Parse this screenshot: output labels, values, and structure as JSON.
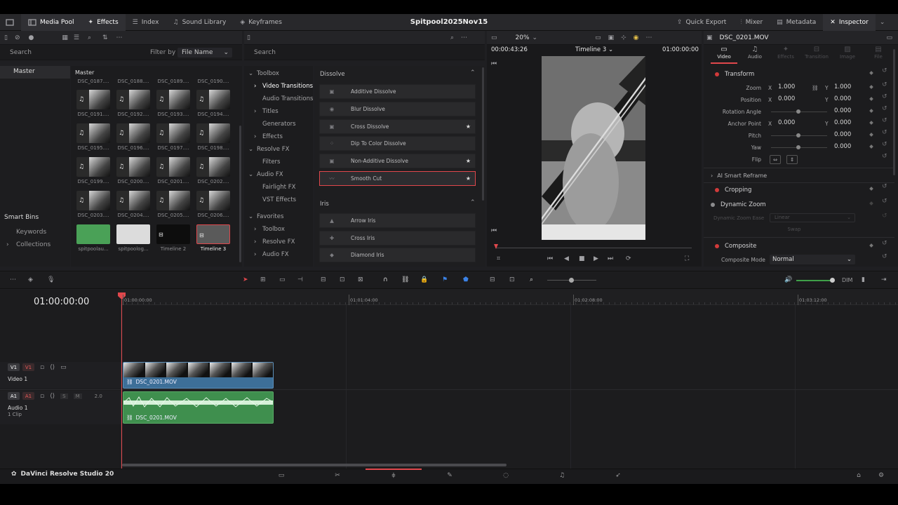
{
  "project_title": "Spitpool2025Nov15",
  "topbar": {
    "media_pool": "Media Pool",
    "effects": "Effects",
    "index": "Index",
    "sound_library": "Sound Library",
    "keyframes": "Keyframes",
    "quick_export": "Quick Export",
    "mixer": "Mixer",
    "metadata": "Metadata",
    "inspector": "Inspector"
  },
  "media": {
    "search_placeholder": "Search",
    "filter_by_label": "Filter by",
    "filter_value": "File Name",
    "master": "Master",
    "grid_header": "Master",
    "smart_bins": "Smart Bins",
    "keywords": "Keywords",
    "collections": "Collections",
    "top_labels": [
      "DSC_0187....",
      "DSC_0188....",
      "DSC_0189....",
      "DSC_0190...."
    ],
    "clips": [
      "DSC_0191....",
      "DSC_0192....",
      "DSC_0193....",
      "DSC_0194....",
      "DSC_0195....",
      "DSC_0196....",
      "DSC_0197....",
      "DSC_0198....",
      "DSC_0199....",
      "DSC_0200....",
      "DSC_0201....",
      "DSC_0202....",
      "DSC_0203....",
      "DSC_0204....",
      "DSC_0205....",
      "DSC_0206....",
      "spitpoolau...",
      "spitpoolog...",
      "Timeline 2",
      "Timeline 3"
    ]
  },
  "effects": {
    "search_placeholder": "Search",
    "tree": [
      {
        "label": "Toolbox",
        "arrow": "⌄",
        "indent": 0
      },
      {
        "label": "Video Transitions",
        "arrow": "›",
        "indent": 1,
        "selected": true
      },
      {
        "label": "Audio Transitions",
        "arrow": "",
        "indent": 1
      },
      {
        "label": "Titles",
        "arrow": "›",
        "indent": 1
      },
      {
        "label": "Generators",
        "arrow": "",
        "indent": 1
      },
      {
        "label": "Effects",
        "arrow": "›",
        "indent": 1
      },
      {
        "label": "Resolve FX",
        "arrow": "⌄",
        "indent": 0
      },
      {
        "label": "Filters",
        "arrow": "",
        "indent": 1
      },
      {
        "label": "Audio FX",
        "arrow": "⌄",
        "indent": 0
      },
      {
        "label": "Fairlight FX",
        "arrow": "",
        "indent": 1
      },
      {
        "label": "VST Effects",
        "arrow": "",
        "indent": 1
      }
    ],
    "favorites": "Favorites",
    "fav_items": [
      "Toolbox",
      "Resolve FX",
      "Audio FX"
    ],
    "dissolve_header": "Dissolve",
    "dissolve": [
      {
        "label": "Additive Dissolve",
        "star": false
      },
      {
        "label": "Blur Dissolve",
        "star": false
      },
      {
        "label": "Cross Dissolve",
        "star": true
      },
      {
        "label": "Dip To Color Dissolve",
        "star": false
      },
      {
        "label": "Non-Additive Dissolve",
        "star": true
      },
      {
        "label": "Smooth Cut",
        "star": true
      }
    ],
    "iris_header": "Iris",
    "iris": [
      "Arrow Iris",
      "Cross Iris",
      "Diamond Iris"
    ]
  },
  "viewer": {
    "zoom": "20%",
    "source_tc": "00:00:43:26",
    "timeline_name": "Timeline 3",
    "record_tc": "01:00:00:00"
  },
  "inspector": {
    "clip_name": "DSC_0201.MOV",
    "tabs": [
      "Video",
      "Audio",
      "Effects",
      "Transition",
      "Image",
      "File"
    ],
    "transform": "Transform",
    "zoom_label": "Zoom",
    "zoom_x": "1.000",
    "zoom_y": "1.000",
    "position_label": "Position",
    "pos_x": "0.000",
    "pos_y": "0.000",
    "rotation_label": "Rotation Angle",
    "rotation": "0.000",
    "anchor_label": "Anchor Point",
    "anchor_x": "0.000",
    "anchor_y": "0.000",
    "pitch_label": "Pitch",
    "pitch": "0.000",
    "yaw_label": "Yaw",
    "yaw": "0.000",
    "flip_label": "Flip",
    "x": "X",
    "y": "Y",
    "ai_reframe": "AI Smart Reframe",
    "cropping": "Cropping",
    "dynamic_zoom": "Dynamic Zoom",
    "dz_ease_label": "Dynamic Zoom Ease",
    "dz_ease_value": "Linear",
    "swap": "Swap",
    "composite": "Composite",
    "composite_mode_label": "Composite Mode",
    "composite_mode_value": "Normal"
  },
  "timeline": {
    "timecode": "01:00:00:00",
    "ruler": [
      "01:00:00:00",
      "01:01:04:00",
      "01:02:08:00",
      "01:03:12:00"
    ],
    "dim": "DIM",
    "v1_label": "V1",
    "video_track": "Video 1",
    "a1_label": "A1",
    "audio_track": "Audio 1",
    "audio_clips": "1 Clip",
    "audio_level": "2.0",
    "s_btn": "S",
    "m_btn": "M",
    "video_clip": "DSC_0201.MOV",
    "audio_clip": "DSC_0201.MOV"
  },
  "footer": {
    "app_name": "DaVinci Resolve Studio 20"
  },
  "colors": {
    "accent_red": "#e0474c",
    "video_clip": "#3d6f98",
    "audio_clip": "#3f8f4e"
  }
}
